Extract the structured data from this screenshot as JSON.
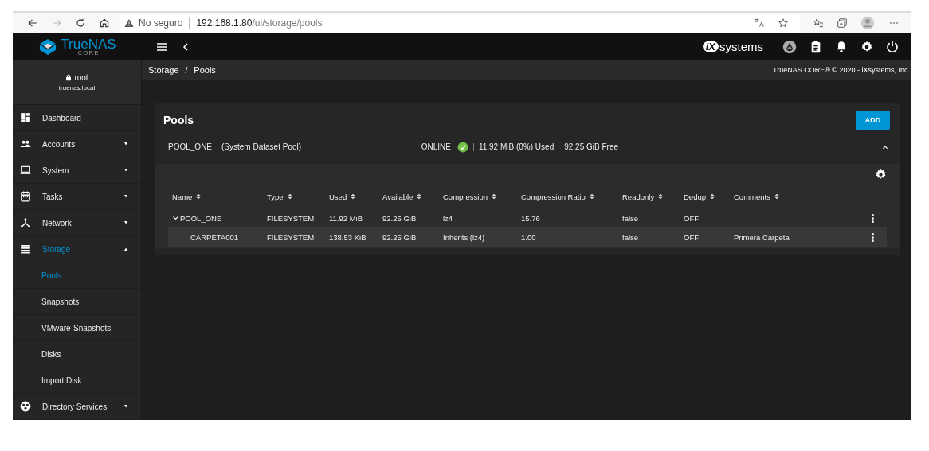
{
  "browser": {
    "security": "No seguro",
    "url_host": "192.168.1.80",
    "url_path": "/ui/storage/pools",
    "forward_disabled": true
  },
  "header": {
    "product": "TrueNAS",
    "edition": "CORE",
    "vendor_mark": "iX",
    "vendor_word": "systems"
  },
  "user": {
    "name": "root",
    "host": "truenas.local"
  },
  "sidebar": {
    "items": [
      {
        "label": "Dashboard",
        "selected": false
      },
      {
        "label": "Accounts",
        "selected": false,
        "expanded": false
      },
      {
        "label": "System",
        "selected": false,
        "expanded": false
      },
      {
        "label": "Tasks",
        "selected": false,
        "expanded": false
      },
      {
        "label": "Network",
        "selected": false,
        "expanded": false
      },
      {
        "label": "Storage",
        "selected": true,
        "expanded": true,
        "children": [
          {
            "label": "Pools",
            "selected": true
          },
          {
            "label": "Snapshots",
            "selected": false
          },
          {
            "label": "VMware-Snapshots",
            "selected": false
          },
          {
            "label": "Disks",
            "selected": false
          },
          {
            "label": "Import Disk",
            "selected": false
          }
        ]
      },
      {
        "label": "Directory Services",
        "selected": false,
        "expanded": false
      }
    ]
  },
  "breadcrumb": [
    "Storage",
    "Pools"
  ],
  "breadcrumb_separator": "/",
  "copyright": "TrueNAS CORE® © 2020 - iXsystems, Inc.",
  "card": {
    "title": "Pools",
    "add_button": "ADD",
    "pool": {
      "name": "POOL_ONE",
      "note": "(System Dataset Pool)",
      "status": "ONLINE",
      "healthy": true,
      "used": "11.92 MiB (0%) Used",
      "free": "92.25 GiB Free",
      "expanded": true
    },
    "table": {
      "columns": [
        "Name",
        "Type",
        "Used",
        "Available",
        "Compression",
        "Compression Ratio",
        "Readonly",
        "Dedup",
        "Comments"
      ],
      "rows": [
        {
          "cells": [
            "POOL_ONE",
            "FILESYSTEM",
            "11.92 MiB",
            "92.25 GiB",
            "lz4",
            "15.76",
            "false",
            "OFF",
            ""
          ],
          "selected": false,
          "expanded": true,
          "children": [
            {
              "cells": [
                "CARPETA001",
                "FILESYSTEM",
                "138.53 KiB",
                "92.25 GiB",
                "Inherits (lz4)",
                "1.00",
                "false",
                "OFF",
                "Primera Carpeta"
              ],
              "selected": true
            }
          ]
        }
      ]
    }
  }
}
